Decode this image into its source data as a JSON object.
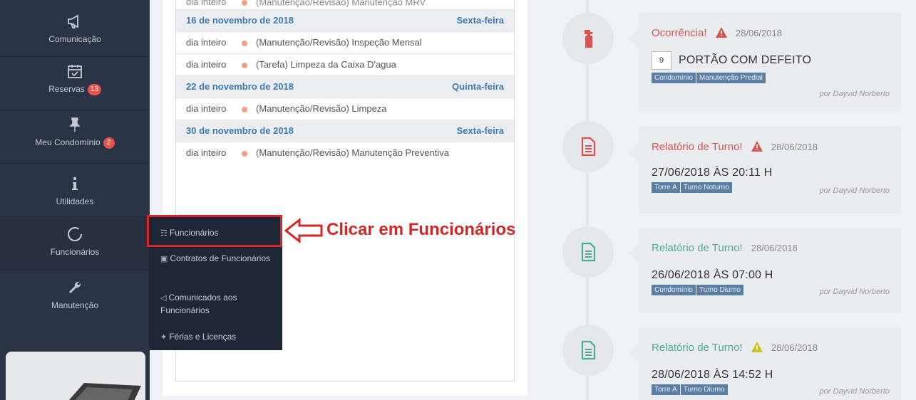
{
  "sidebar": {
    "items": [
      {
        "label": "Comunicação",
        "icon": "megaphone-icon"
      },
      {
        "label": "Reservas",
        "badge": "13",
        "icon": "calendar-check-icon"
      },
      {
        "label": "Meu Condomínio",
        "badge": "2",
        "icon": "pin-icon"
      },
      {
        "label": "Utilidades",
        "icon": "info-icon"
      },
      {
        "label": "Funcionários",
        "icon": "circle-icon"
      },
      {
        "label": "Manutenção",
        "icon": "wrench-icon"
      }
    ]
  },
  "calendar": {
    "cut_row": {
      "time": "dia inteiro",
      "text": "(Manutenção/Revisão) Manutenção MRV"
    },
    "groups": [
      {
        "date": "16 de novembro de 2018",
        "weekday": "Sexta-feira",
        "events": [
          {
            "time": "dia inteiro",
            "text": "(Manutenção/Revisão) Inspeção Mensal"
          },
          {
            "time": "dia inteiro",
            "text": "(Tarefa) Limpeza da Caixa D'agua"
          }
        ]
      },
      {
        "date": "22 de novembro de 2018",
        "weekday": "Quinta-feira",
        "events": [
          {
            "time": "dia inteiro",
            "text": "(Manutenção/Revisão) Limpeza"
          }
        ]
      },
      {
        "date": "30 de novembro de 2018",
        "weekday": "Sexta-feira",
        "events": [
          {
            "time": "dia inteiro",
            "text": "(Manutenção/Revisão) Manutenção Preventiva"
          }
        ]
      }
    ]
  },
  "dropdown": {
    "items": [
      {
        "label": "Funcionários",
        "icon": "sitemap-icon"
      },
      {
        "label": "Contratos de Funcionários",
        "icon": "briefcase-icon"
      },
      {
        "label": "Comunicados aos Funcionários",
        "icon": "megaphone-icon"
      },
      {
        "label": "Férias e Licenças",
        "icon": "plane-icon"
      }
    ]
  },
  "annotation": {
    "callout": "Clicar em Funcionários",
    "color": "#d32626"
  },
  "timeline": {
    "cards": [
      {
        "title": "Ocorrência!",
        "warn": "red",
        "date": "28/06/2018",
        "number": "9",
        "body": "PORTÃO COM DEFEITO",
        "tags": [
          "Condomínio",
          "Manutenção Predial"
        ],
        "by": "por Dayvid Norberto",
        "icon": "fire-extinguisher-icon"
      },
      {
        "title": "Relatório de Turno!",
        "warn": "red",
        "date": "28/06/2018",
        "body": "27/06/2018 ÀS 20:11 H",
        "tags": [
          "Torre A",
          "Turno Noturno"
        ],
        "by": "por Dayvid Norberto",
        "icon": "document-red-icon"
      },
      {
        "title": "Relatório de Turno!",
        "date": "28/06/2018",
        "body": "26/06/2018 ÀS 07:00 H",
        "tags": [
          "Condomínio",
          "Turno Diurno"
        ],
        "by": "por Dayvid Norberto",
        "icon": "document-green-icon"
      },
      {
        "title": "Relatório de Turno!",
        "warn": "yellow",
        "date": "28/06/2018",
        "body": "28/06/2018 ÀS 14:52 H",
        "tags": [
          "Torre A",
          "Turno Diurno"
        ],
        "by": "por Dayvid Norberto",
        "icon": "document-green-icon"
      }
    ]
  },
  "colors": {
    "sidebar": "#2b3446",
    "accent_red": "#d9534f",
    "accent_green": "#4cab96",
    "date_blue": "#3d7ab5",
    "tag": "#5b7fa3"
  }
}
